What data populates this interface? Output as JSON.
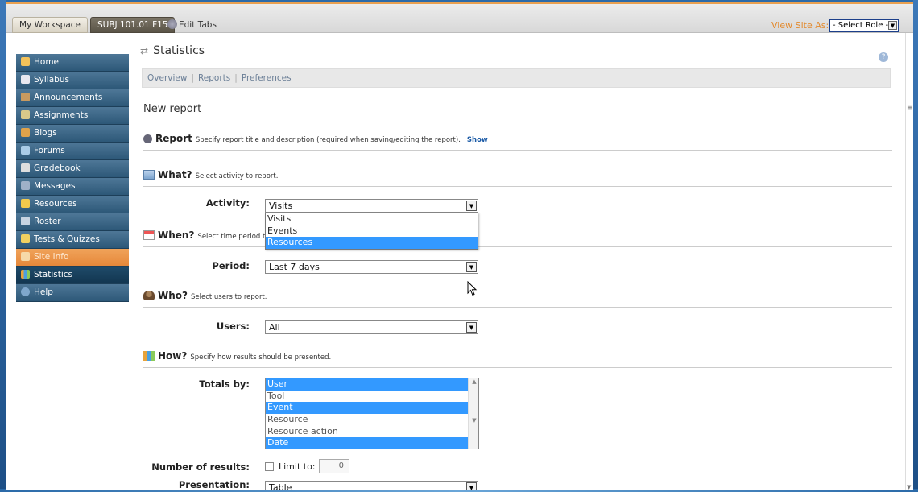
{
  "topnav": {
    "tabs": [
      {
        "label": "My Workspace"
      },
      {
        "label": "SUBJ 101.01 F15"
      }
    ],
    "edit_tabs": "Edit Tabs",
    "view_site_as": "View Site As:",
    "role_select": "- Select Role -"
  },
  "toolmenu": {
    "items": [
      {
        "label": "Home",
        "icon": "home-icon"
      },
      {
        "label": "Syllabus",
        "icon": "syllabus-icon"
      },
      {
        "label": "Announcements",
        "icon": "announcements-icon"
      },
      {
        "label": "Assignments",
        "icon": "assignments-icon"
      },
      {
        "label": "Blogs",
        "icon": "blogs-icon"
      },
      {
        "label": "Forums",
        "icon": "forums-icon"
      },
      {
        "label": "Gradebook",
        "icon": "gradebook-icon"
      },
      {
        "label": "Messages",
        "icon": "messages-icon"
      },
      {
        "label": "Resources",
        "icon": "resources-icon"
      },
      {
        "label": "Roster",
        "icon": "roster-icon"
      },
      {
        "label": "Tests & Quizzes",
        "icon": "tests-icon"
      },
      {
        "label": "Site Info",
        "icon": "site-info-icon"
      },
      {
        "label": "Statistics",
        "icon": "statistics-icon"
      },
      {
        "label": "Help",
        "icon": "help-icon"
      }
    ]
  },
  "main": {
    "title": "Statistics",
    "subnav": [
      "Overview",
      "Reports",
      "Preferences"
    ],
    "heading": "New report",
    "report": {
      "title": "Report",
      "desc": "Specify report title and description (required when saving/editing the report).",
      "show": "Show"
    },
    "what": {
      "title": "What?",
      "desc": "Select activity to report."
    },
    "activity": {
      "label": "Activity:",
      "value": "Visits",
      "options": [
        "Visits",
        "Events",
        "Resources"
      ],
      "highlighted": "Resources"
    },
    "when": {
      "title": "When?",
      "desc": "Select time period t"
    },
    "period": {
      "label": "Period:",
      "value": "Last 7 days"
    },
    "who": {
      "title": "Who?",
      "desc": "Select users to report."
    },
    "users": {
      "label": "Users:",
      "value": "All"
    },
    "how": {
      "title": "How?",
      "desc": "Specify how results should be presented."
    },
    "totals": {
      "label": "Totals by:",
      "options": [
        "User",
        "Tool",
        "Event",
        "Resource",
        "Resource action",
        "Date"
      ],
      "selected": [
        "User",
        "Event",
        "Date"
      ]
    },
    "num_results": {
      "label": "Number of results:",
      "limit_label": "Limit to:",
      "limit_value": "0"
    },
    "presentation": {
      "label": "Presentation:",
      "value": "Table"
    }
  },
  "colors": {
    "accent": "#e38a2e",
    "tool_bg": "#2d5878",
    "highlight": "#3399ff"
  }
}
